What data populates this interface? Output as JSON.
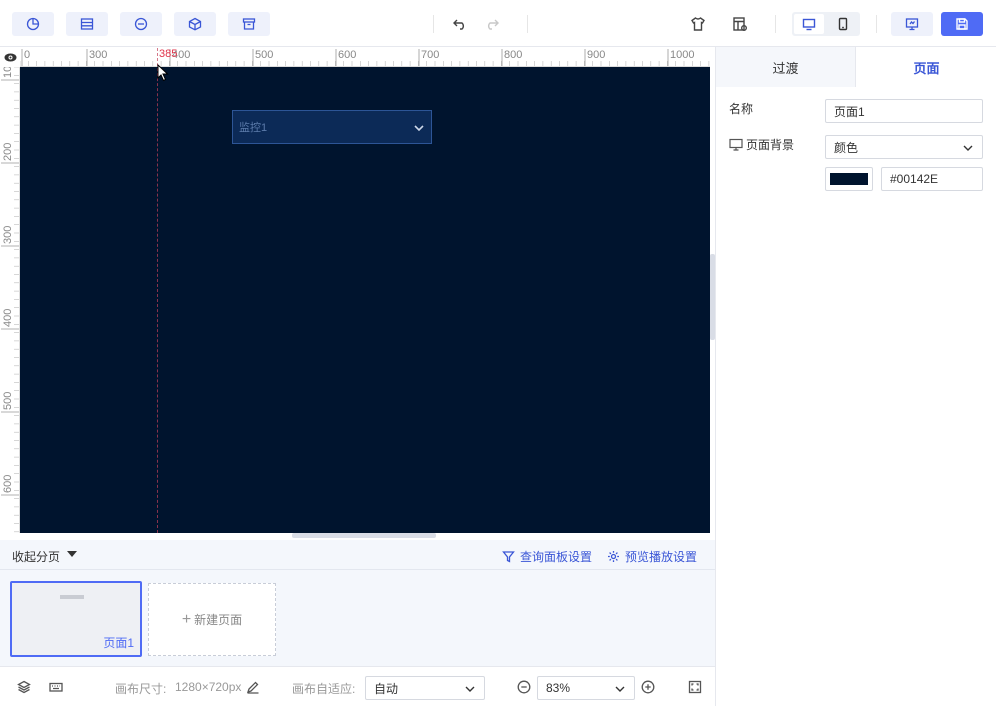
{
  "toolbar": {
    "left_buttons": [
      {
        "icon": "chart-icon"
      },
      {
        "icon": "table-icon"
      },
      {
        "icon": "media-icon"
      },
      {
        "icon": "cube-icon"
      },
      {
        "icon": "archive-icon"
      }
    ],
    "undo_icon": "undo-icon",
    "redo_icon": "redo-icon",
    "right_icons": [
      "theme-shirt-icon",
      "layout-settings-icon"
    ],
    "device_buttons": [
      "desktop-icon",
      "tablet-icon"
    ],
    "preview_icon": "preview-screen-icon",
    "save_icon": "save-icon",
    "accent_color": "#4F6BF5"
  },
  "ruler": {
    "horizontal_ticks": [
      "0",
      "300",
      "400",
      "500",
      "600",
      "700",
      "800",
      "900",
      "1000"
    ],
    "vertical_ticks": [
      "100",
      "200",
      "300",
      "400",
      "500",
      "600"
    ],
    "marker_value": "385"
  },
  "canvas": {
    "background": "#00142E",
    "widget": {
      "placeholder": "监控1"
    }
  },
  "pages": {
    "collapse_label": "收起分页",
    "query_panel_link": "查询面板设置",
    "preview_link": "预览播放设置",
    "items": [
      {
        "label": "页面1"
      }
    ],
    "new_page_label": "新建页面"
  },
  "statusbar": {
    "canvas_size_label": "画布尺寸:",
    "canvas_size_value": "1280×720px",
    "adaptive_label": "画布自适应:",
    "adaptive_value": "自动",
    "zoom_value": "83%"
  },
  "panel": {
    "tabs": [
      "过渡",
      "页面"
    ],
    "active_tab": "页面",
    "name_label": "名称",
    "name_value": "页面1",
    "bg_label": "页面背景",
    "bg_type": "颜色",
    "bg_color": "#00142E",
    "bg_color_text": "#00142E"
  }
}
